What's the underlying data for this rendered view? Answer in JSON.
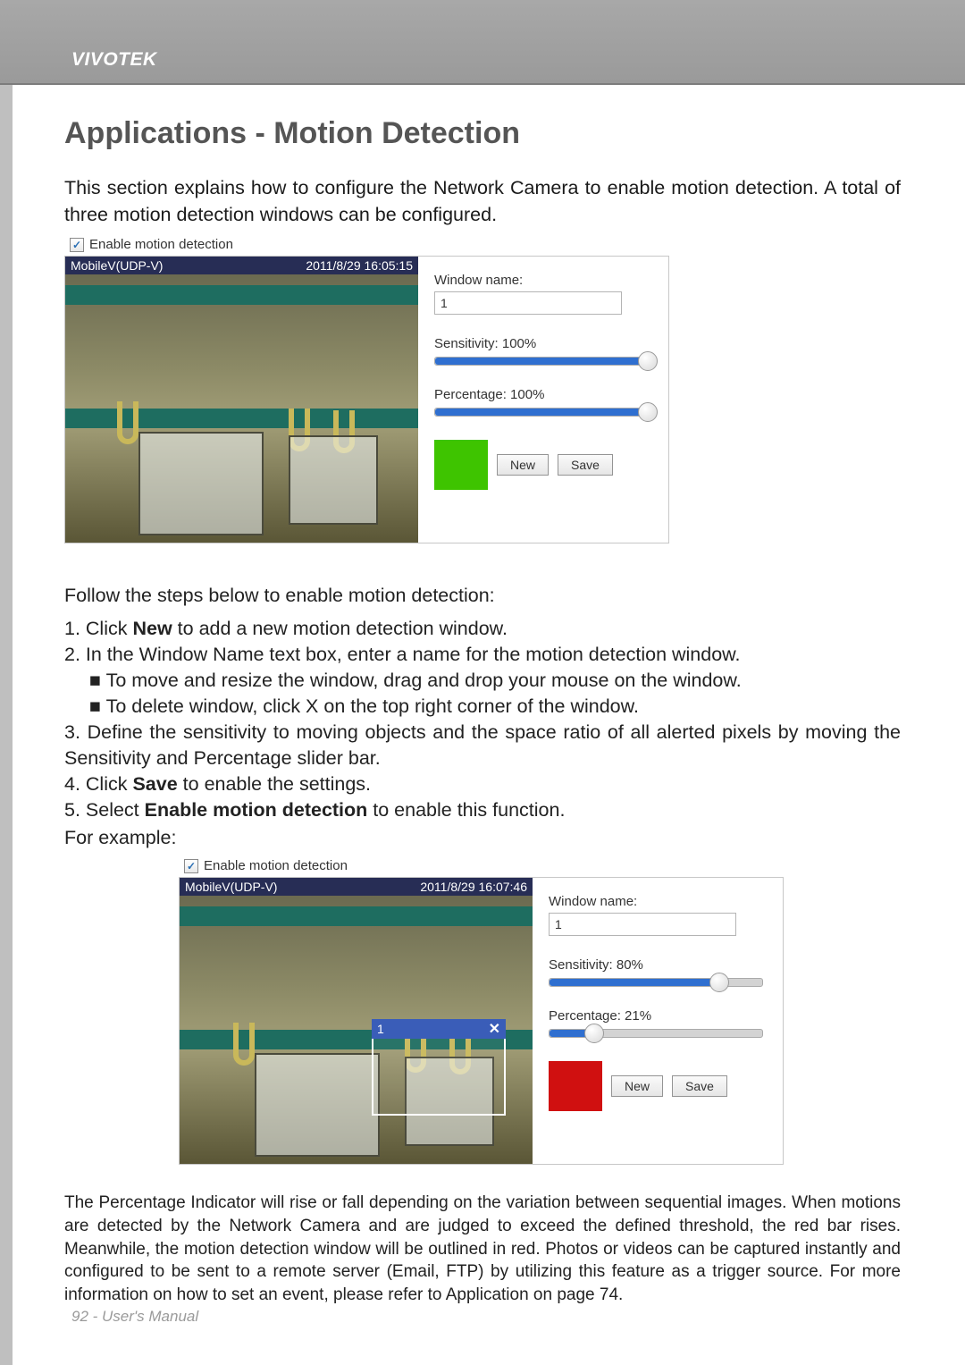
{
  "header": {
    "brand": "VIVOTEK"
  },
  "title": "Applications - Motion Detection",
  "intro": "This section explains how to configure the Network Camera to enable motion detection. A total of three motion detection windows can be configured.",
  "screenshot1": {
    "enable_label": "Enable motion detection",
    "enable_checked": true,
    "video": {
      "stream_name": "MobileV(UDP-V)",
      "timestamp": "2011/8/29 16:05:15"
    },
    "panel": {
      "window_name_label": "Window name:",
      "window_name_value": "1",
      "sensitivity_label": "Sensitivity: 100%",
      "sensitivity_pct": 100,
      "percentage_label": "Percentage: 100%",
      "percentage_pct": 100,
      "indicator_color": "#3ec400",
      "new_label": "New",
      "save_label": "Save"
    }
  },
  "steps": {
    "intro": "Follow the steps below to enable motion detection:",
    "s1_a": "1. Click ",
    "s1_b": "New",
    "s1_c": " to add a new motion detection window.",
    "s2": "2. In the Window Name text box, enter a name for the motion detection window.",
    "s2a": "■ To move and resize the window, drag and drop your mouse on the window.",
    "s2b": "■ To delete window, click X on the top right corner of the window.",
    "s3": "3. Define the sensitivity to moving objects and the space ratio of all alerted pixels by moving the Sensitivity and Percentage slider bar.",
    "s4_a": "4. Click ",
    "s4_b": "Save",
    "s4_c": " to enable the settings.",
    "s5_a": "5. Select ",
    "s5_b": "Enable motion detection",
    "s5_c": " to enable this function.",
    "example": "For example:"
  },
  "screenshot2": {
    "enable_label": "Enable motion detection",
    "enable_checked": true,
    "video": {
      "stream_name": "MobileV(UDP-V)",
      "timestamp": "2011/8/29 16:07:46",
      "md_window": {
        "label": "1",
        "close": "✕"
      }
    },
    "panel": {
      "window_name_label": "Window name:",
      "window_name_value": "1",
      "sensitivity_label": "Sensitivity: 80%",
      "sensitivity_pct": 80,
      "percentage_label": "Percentage: 21%",
      "percentage_pct": 21,
      "indicator_color": "#d01010",
      "new_label": "New",
      "save_label": "Save"
    }
  },
  "bottom": "The Percentage Indicator will rise or fall depending on the variation between sequential images. When motions are detected by the Network Camera and are judged to exceed the defined threshold, the red bar rises. Meanwhile, the motion detection window will be outlined in red. Photos or videos can be captured instantly and configured to be sent to a remote server (Email, FTP) by utilizing this feature as a trigger source. For more information on how to set an event, please refer to Application on page 74.",
  "footer": "92 - User's Manual"
}
